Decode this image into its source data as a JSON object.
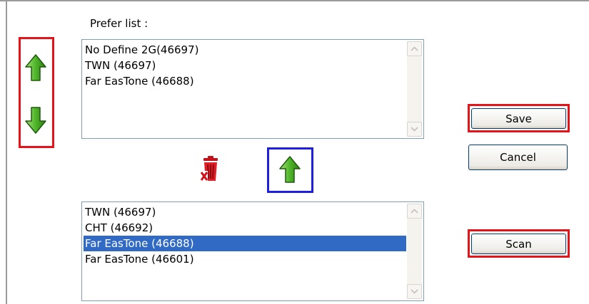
{
  "prefer_list": {
    "label": "Prefer list :",
    "items": [
      {
        "label": "No Define 2G(46697)"
      },
      {
        "label": "TWN (46697)"
      },
      {
        "label": "Far EasTone (46688)"
      }
    ]
  },
  "scan_list": {
    "items": [
      {
        "label": "TWN (46697)"
      },
      {
        "label": "CHT (46692)"
      },
      {
        "label": "Far EasTone (46688)",
        "selected": true
      },
      {
        "label": "Far EasTone (46601)"
      }
    ]
  },
  "buttons": {
    "save_label": "Save",
    "cancel_label": "Cancel",
    "scan_label": "Scan"
  },
  "icons": {
    "move_up": "green-up-arrow-icon",
    "move_down": "green-down-arrow-icon",
    "delete": "trash-can-icon",
    "add_to_prefer": "green-up-arrow-icon"
  },
  "colors": {
    "highlight_red": "#e5141b",
    "highlight_blue": "#1f1fe0",
    "selection": "#316ac5",
    "arrow_green": "#3a9a1c"
  }
}
